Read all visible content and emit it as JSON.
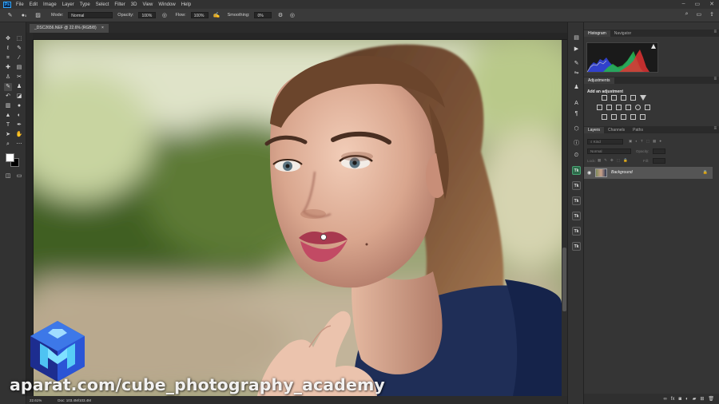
{
  "app": {
    "logo_text": "Ps"
  },
  "menu": [
    "File",
    "Edit",
    "Image",
    "Layer",
    "Type",
    "Select",
    "Filter",
    "3D",
    "View",
    "Window",
    "Help"
  ],
  "window_controls": [
    "–",
    "▭",
    "✕"
  ],
  "options_bar": {
    "brush_size": "5",
    "mode_label": "Mode:",
    "mode_value": "Normal",
    "opacity_label": "Opacity:",
    "opacity_value": "100%",
    "flow_label": "Flow:",
    "flow_value": "100%",
    "smoothing_label": "Smoothing:",
    "smoothing_value": "0%"
  },
  "document": {
    "tab_title": "_DSC2656.NEF @ 22.6% (RGB/8)",
    "tab_close": "×"
  },
  "status_bar": {
    "zoom": "22.61%",
    "doc_size": "Doc: 103.4M/103.4M"
  },
  "panels": {
    "top_tabs": [
      {
        "label": "Histogram",
        "active": true
      },
      {
        "label": "Navigator",
        "active": false
      }
    ],
    "adjustments_tab": "Adjustments",
    "adjustments_subtitle": "Add an adjustment",
    "layers_tabs": [
      {
        "label": "Layers",
        "active": true
      },
      {
        "label": "Channels",
        "active": false
      },
      {
        "label": "Paths",
        "active": false
      }
    ],
    "layers_kind": "Kind",
    "layers_blend": "Normal",
    "layers_opacity_label": "Opacity:",
    "layers_fill_label": "Fill:",
    "layers_lock_label": "Lock:",
    "layer_name": "Background"
  },
  "colors": {
    "foreground": "#ffffff",
    "background": "#000000",
    "accent": "#31a8ff"
  },
  "watermark": {
    "text": "aparat.com/cube_photography_academy"
  }
}
